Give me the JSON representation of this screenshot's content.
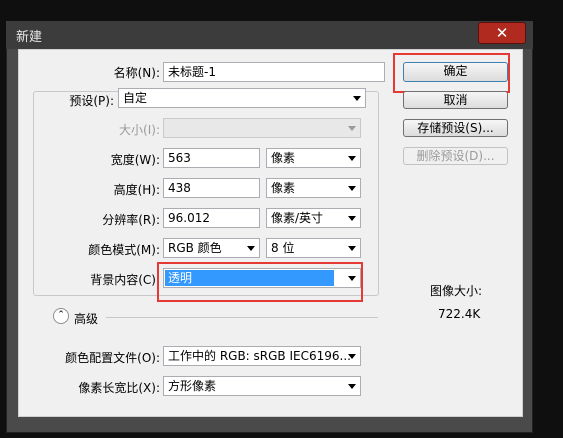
{
  "window": {
    "title": "新建",
    "close_icon": "close-icon"
  },
  "form": {
    "name": {
      "label": "名称(N):",
      "value": "未标题-1"
    },
    "preset": {
      "label": "预设(P):",
      "value": "自定"
    },
    "size": {
      "label": "大小(I):",
      "value": ""
    },
    "width": {
      "label": "宽度(W):",
      "value": "563",
      "unit": "像素"
    },
    "height": {
      "label": "高度(H):",
      "value": "438",
      "unit": "像素"
    },
    "resolution": {
      "label": "分辨率(R):",
      "value": "96.012",
      "unit": "像素/英寸"
    },
    "color_mode": {
      "label": "颜色模式(M):",
      "value": "RGB 颜色",
      "depth": "8 位"
    },
    "background": {
      "label": "背景内容(C):",
      "value": "透明"
    },
    "advanced": {
      "label": "高级"
    },
    "color_profile": {
      "label": "颜色配置文件(O):",
      "value": "工作中的 RGB: sRGB IEC6196..."
    },
    "pixel_aspect": {
      "label": "像素长宽比(X):",
      "value": "方形像素"
    }
  },
  "buttons": {
    "ok": "确定",
    "cancel": "取消",
    "save_preset": "存储预设(S)...",
    "delete_preset": "删除预设(D)..."
  },
  "info": {
    "size_label": "图像大小:",
    "size_value": "722.4K"
  },
  "colors": {
    "highlight": "#e53935",
    "selection": "#3399ff"
  }
}
